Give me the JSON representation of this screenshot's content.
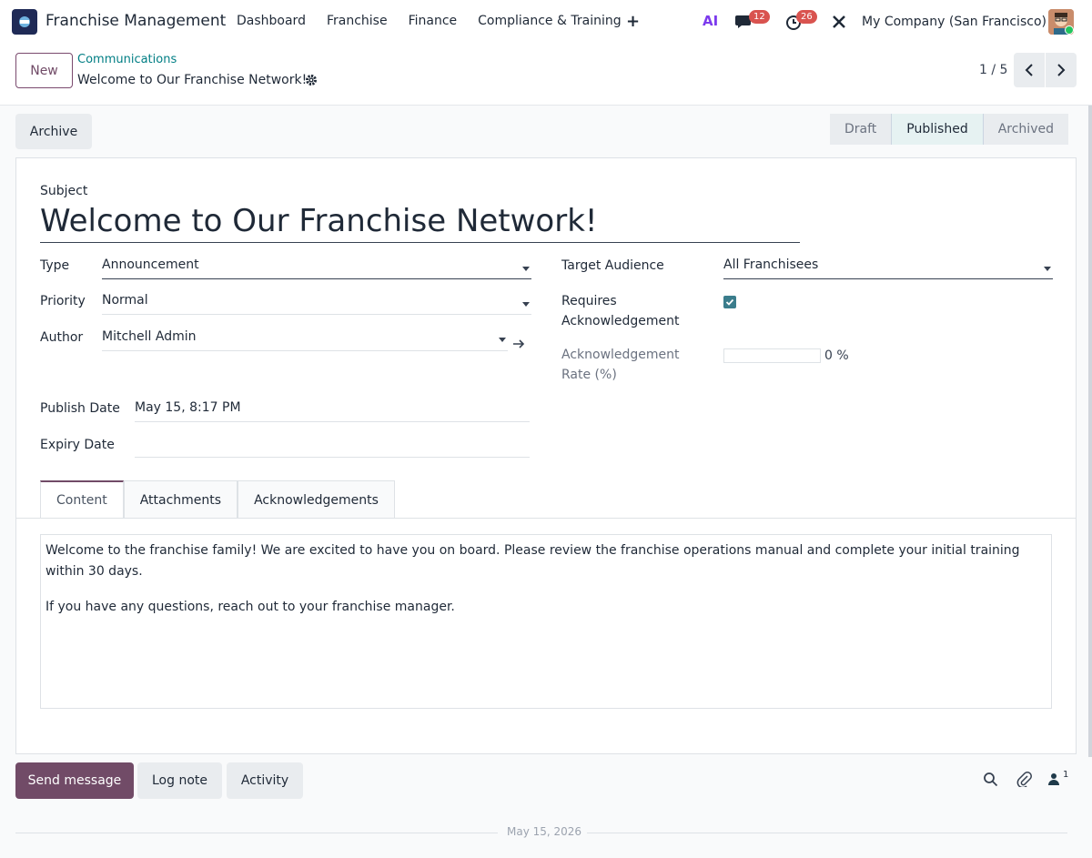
{
  "navbar": {
    "app_title": "Franchise Management",
    "menu": [
      "Dashboard",
      "Franchise",
      "Finance",
      "Compliance & Training"
    ],
    "plus": "+",
    "ai_label": "AI",
    "chat_badge": "12",
    "activity_badge": "26",
    "company": "My Company (San Francisco)"
  },
  "control": {
    "new_label": "New",
    "breadcrumb_parent": "Communications",
    "breadcrumb_current": "Welcome to Our Franchise Network!",
    "pager": "1 / 5"
  },
  "actions": {
    "archive_label": "Archive"
  },
  "statusbar": {
    "steps": [
      "Draft",
      "Published",
      "Archived"
    ],
    "active": "Published"
  },
  "form": {
    "subject_label": "Subject",
    "subject": "Welcome to Our Franchise Network!",
    "type_label": "Type",
    "type": "Announcement",
    "priority_label": "Priority",
    "priority": "Normal",
    "author_label": "Author",
    "author": "Mitchell Admin",
    "publish_date_label": "Publish Date",
    "publish_date": "May 15, 8:17 PM",
    "expiry_date_label": "Expiry Date",
    "expiry_date": "",
    "target_audience_label": "Target Audience",
    "target_audience": "All Franchisees",
    "requires_ack_label_1": "Requires",
    "requires_ack_label_2": "Acknowledgement",
    "requires_ack": true,
    "ack_rate_label_1": "Acknowledgement",
    "ack_rate_label_2": "Rate (%)",
    "ack_rate": 0,
    "ack_rate_text": "0 %"
  },
  "tabs": [
    "Content",
    "Attachments",
    "Acknowledgements"
  ],
  "content": {
    "paragraph_1": "Welcome to the franchise family! We are excited to have you on board. Please review the franchise operations manual and complete your initial training within 30 days.",
    "paragraph_2": "If you have any questions, reach out to your franchise manager."
  },
  "chatter": {
    "send_label": "Send message",
    "log_label": "Log note",
    "activity_label": "Activity",
    "follower_count": "1",
    "date_separator": "May 15, 2026"
  },
  "colors": {
    "brand": "#714b67",
    "accent": "#3b7d8c",
    "link": "#017e84"
  }
}
